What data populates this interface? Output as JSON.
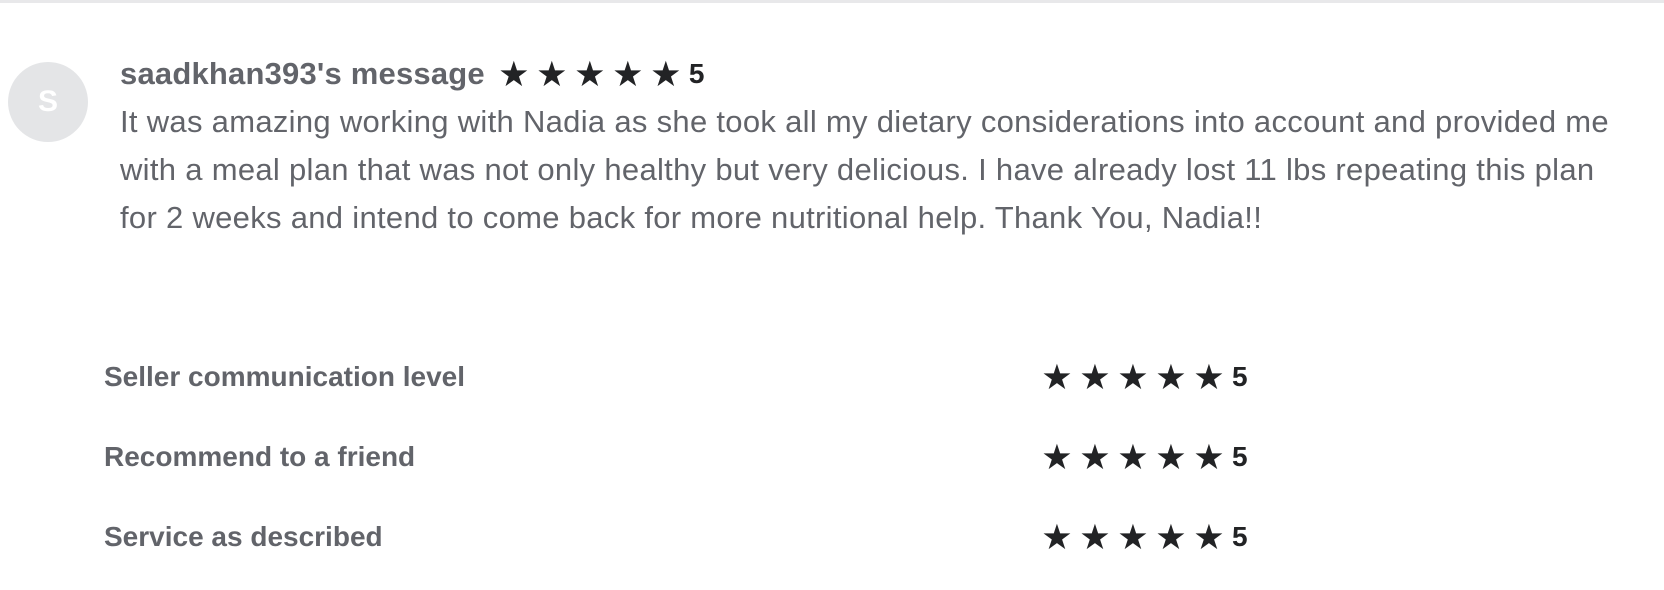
{
  "avatar": {
    "initial": "S"
  },
  "review": {
    "title": "saadkhan393's message",
    "rating": 5,
    "rating_text": "5",
    "body": "It was amazing working with Nadia as she took all my dietary considerations into account and provided me with a meal plan that was not only healthy but very delicious. I have already lost 11 lbs repeating this plan for 2 weeks and intend to come back for more nutritional help. Thank You, Nadia!!"
  },
  "breakdown": [
    {
      "label": "Seller communication level",
      "rating": 5,
      "rating_text": "5"
    },
    {
      "label": "Recommend to a friend",
      "rating": 5,
      "rating_text": "5"
    },
    {
      "label": "Service as described",
      "rating": 5,
      "rating_text": "5"
    }
  ],
  "icons": {
    "star": "star-icon"
  },
  "colors": {
    "star": "#222325",
    "text": "#62646a",
    "avatar_bg": "#e4e5e7"
  }
}
